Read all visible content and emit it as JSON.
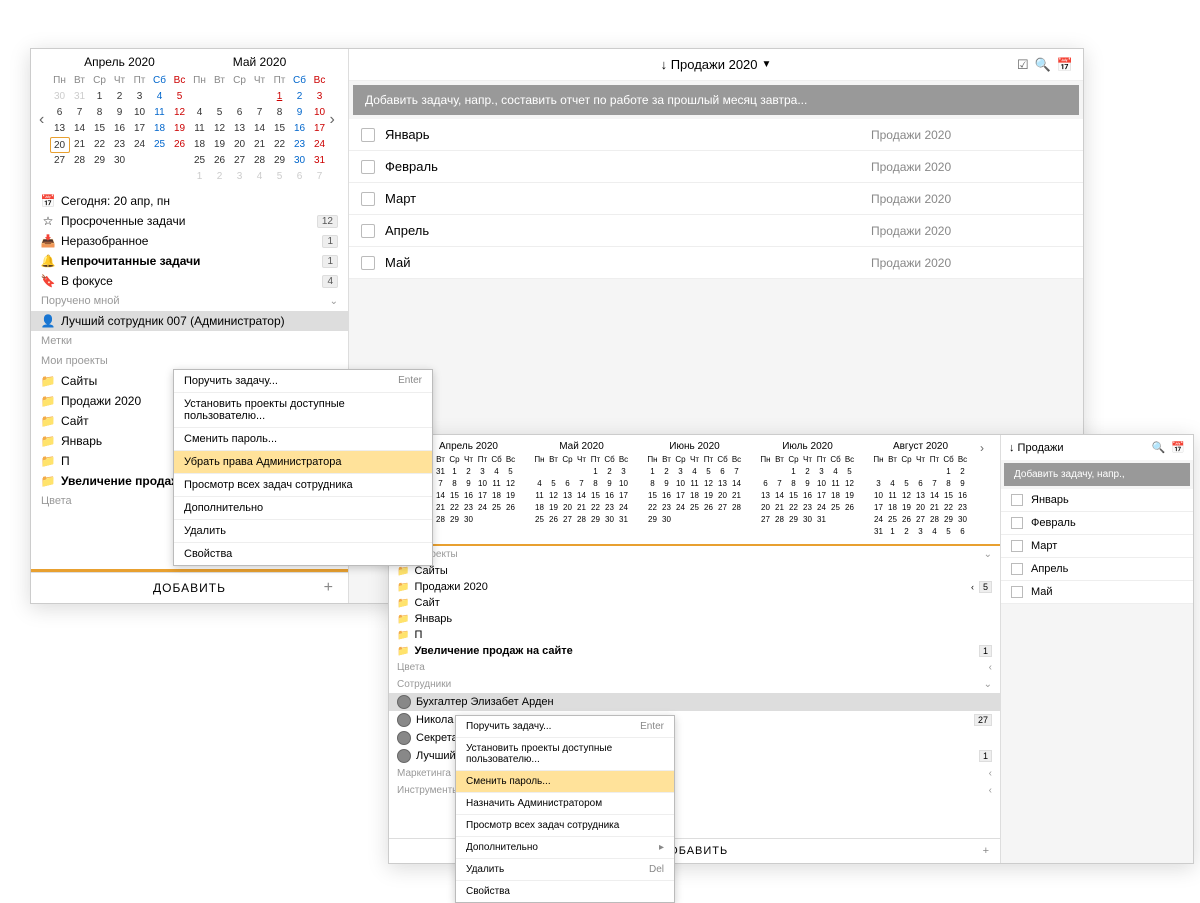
{
  "window1": {
    "calendar": {
      "months": [
        {
          "title": "Апрель 2020",
          "headers": [
            "Пн",
            "Вт",
            "Ср",
            "Чт",
            "Пт",
            "Сб",
            "Вс"
          ],
          "days": [
            {
              "d": "30",
              "dim": true
            },
            {
              "d": "31",
              "dim": true
            },
            {
              "d": "1"
            },
            {
              "d": "2"
            },
            {
              "d": "3"
            },
            {
              "d": "4",
              "sat": true
            },
            {
              "d": "5",
              "sun": true
            },
            {
              "d": "6"
            },
            {
              "d": "7"
            },
            {
              "d": "8"
            },
            {
              "d": "9"
            },
            {
              "d": "10"
            },
            {
              "d": "11",
              "sat": true
            },
            {
              "d": "12",
              "sun": true
            },
            {
              "d": "13"
            },
            {
              "d": "14"
            },
            {
              "d": "15"
            },
            {
              "d": "16"
            },
            {
              "d": "17"
            },
            {
              "d": "18",
              "sat": true
            },
            {
              "d": "19",
              "sun": true
            },
            {
              "d": "20",
              "today": true
            },
            {
              "d": "21"
            },
            {
              "d": "22"
            },
            {
              "d": "23"
            },
            {
              "d": "24"
            },
            {
              "d": "25",
              "sat": true
            },
            {
              "d": "26",
              "sun": true
            },
            {
              "d": "27"
            },
            {
              "d": "28"
            },
            {
              "d": "29"
            },
            {
              "d": "30"
            }
          ]
        },
        {
          "title": "Май 2020",
          "headers": [
            "Пн",
            "Вт",
            "Ср",
            "Чт",
            "Пт",
            "Сб",
            "Вс"
          ],
          "days": [
            {
              "d": ""
            },
            {
              "d": ""
            },
            {
              "d": ""
            },
            {
              "d": ""
            },
            {
              "d": "1",
              "mark": true
            },
            {
              "d": "2",
              "sat": true
            },
            {
              "d": "3",
              "sun": true
            },
            {
              "d": "4"
            },
            {
              "d": "5"
            },
            {
              "d": "6"
            },
            {
              "d": "7"
            },
            {
              "d": "8"
            },
            {
              "d": "9",
              "sat": true
            },
            {
              "d": "10",
              "sun": true
            },
            {
              "d": "11"
            },
            {
              "d": "12"
            },
            {
              "d": "13"
            },
            {
              "d": "14"
            },
            {
              "d": "15"
            },
            {
              "d": "16",
              "sat": true
            },
            {
              "d": "17",
              "sun": true
            },
            {
              "d": "18"
            },
            {
              "d": "19"
            },
            {
              "d": "20"
            },
            {
              "d": "21"
            },
            {
              "d": "22"
            },
            {
              "d": "23",
              "sat": true
            },
            {
              "d": "24",
              "sun": true
            },
            {
              "d": "25"
            },
            {
              "d": "26"
            },
            {
              "d": "27"
            },
            {
              "d": "28"
            },
            {
              "d": "29"
            },
            {
              "d": "30",
              "sat": true
            },
            {
              "d": "31",
              "sun": true
            },
            {
              "d": "1",
              "dim": true
            },
            {
              "d": "2",
              "dim": true
            },
            {
              "d": "3",
              "dim": true
            },
            {
              "d": "4",
              "dim": true
            },
            {
              "d": "5",
              "dim": true
            },
            {
              "d": "6",
              "dim": true
            },
            {
              "d": "7",
              "dim": true
            }
          ]
        }
      ]
    },
    "nav": {
      "today": "Сегодня: 20 апр, пн",
      "overdue": {
        "label": "Просроченные задачи",
        "badge": "12"
      },
      "inbox": {
        "label": "Неразобранное",
        "badge": "1"
      },
      "unread": {
        "label": "Непрочитанные задачи",
        "badge": "1"
      },
      "focus": {
        "label": "В фокусе",
        "badge": "4"
      }
    },
    "sections": {
      "delegated": "Поручено мной",
      "employee": "Лучший сотрудник 007 (Администратор)",
      "tags": "Метки",
      "projects": "Мои проекты",
      "colors": "Цвета"
    },
    "projects": [
      {
        "label": "Сайты"
      },
      {
        "label": "Продажи 2020"
      },
      {
        "label": "Сайт"
      },
      {
        "label": "Январь"
      },
      {
        "label": "П"
      },
      {
        "label": "Увеличение продаж на сайте",
        "badge": "1",
        "bold": true
      }
    ],
    "addBtn": "ДОБАВИТЬ",
    "title": "↓ Продажи 2020",
    "addTask": "Добавить задачу, напр., составить отчет по работе за прошлый месяц завтра...",
    "tasks": [
      {
        "name": "Январь",
        "proj": "Продажи 2020"
      },
      {
        "name": "Февраль",
        "proj": "Продажи 2020"
      },
      {
        "name": "Март",
        "proj": "Продажи 2020"
      },
      {
        "name": "Апрель",
        "proj": "Продажи 2020"
      },
      {
        "name": "Май",
        "proj": "Продажи 2020"
      }
    ],
    "ctxmenu": [
      {
        "label": "Поручить задачу...",
        "sc": "Enter"
      },
      {
        "label": "Установить проекты доступные пользователю..."
      },
      {
        "label": "Сменить пароль..."
      },
      {
        "label": "Убрать права Администратора",
        "hl": true
      },
      {
        "label": "Просмотр всех задач сотрудника"
      },
      {
        "label": "Дополнительно"
      },
      {
        "label": "Удалить"
      },
      {
        "label": "Свойства"
      }
    ]
  },
  "window2": {
    "months": [
      {
        "title": "Апрель 2020"
      },
      {
        "title": "Май 2020"
      },
      {
        "title": "Июнь 2020"
      },
      {
        "title": "Июль 2020"
      },
      {
        "title": "Август 2020"
      }
    ],
    "headers": [
      "Пн",
      "Вт",
      "Ср",
      "Чт",
      "Пт",
      "Сб",
      "Вс"
    ],
    "sections": {
      "projects": "Мои проекты",
      "colors": "Цвета",
      "employees": "Сотрудники",
      "marketing": "Маркетинга",
      "tools": "Инструменты"
    },
    "projects": [
      {
        "label": "Сайты"
      },
      {
        "label": "Продажи 2020",
        "badge": "5",
        "chev": true
      },
      {
        "label": "Сайт"
      },
      {
        "label": "Январь"
      },
      {
        "label": "П"
      },
      {
        "label": "Увеличение продаж на сайте",
        "badge": "1",
        "bold": true
      }
    ],
    "employees": [
      {
        "label": "Бухгалтер Элизабет Арден",
        "sel": true
      },
      {
        "label": "Никола",
        "badge": "27"
      },
      {
        "label": "Секретар"
      },
      {
        "label": "Лучший",
        "badge": "1"
      }
    ],
    "ctxmenu": [
      {
        "label": "Поручить задачу...",
        "sc": "Enter"
      },
      {
        "label": "Установить проекты доступные пользователю..."
      },
      {
        "label": "Сменить пароль...",
        "hl": true
      },
      {
        "label": "Назначить Администратором"
      },
      {
        "label": "Просмотр всех задач сотрудника"
      },
      {
        "label": "Дополнительно",
        "sc": "▸"
      },
      {
        "label": "Удалить",
        "sc": "Del"
      },
      {
        "label": "Свойства"
      }
    ],
    "addBtn": "ДОБАВИТЬ",
    "rtitle": "↓ Продажи",
    "addTask": "Добавить задачу, напр.,",
    "tasks": [
      "Январь",
      "Февраль",
      "Март",
      "Апрель",
      "Май"
    ]
  }
}
